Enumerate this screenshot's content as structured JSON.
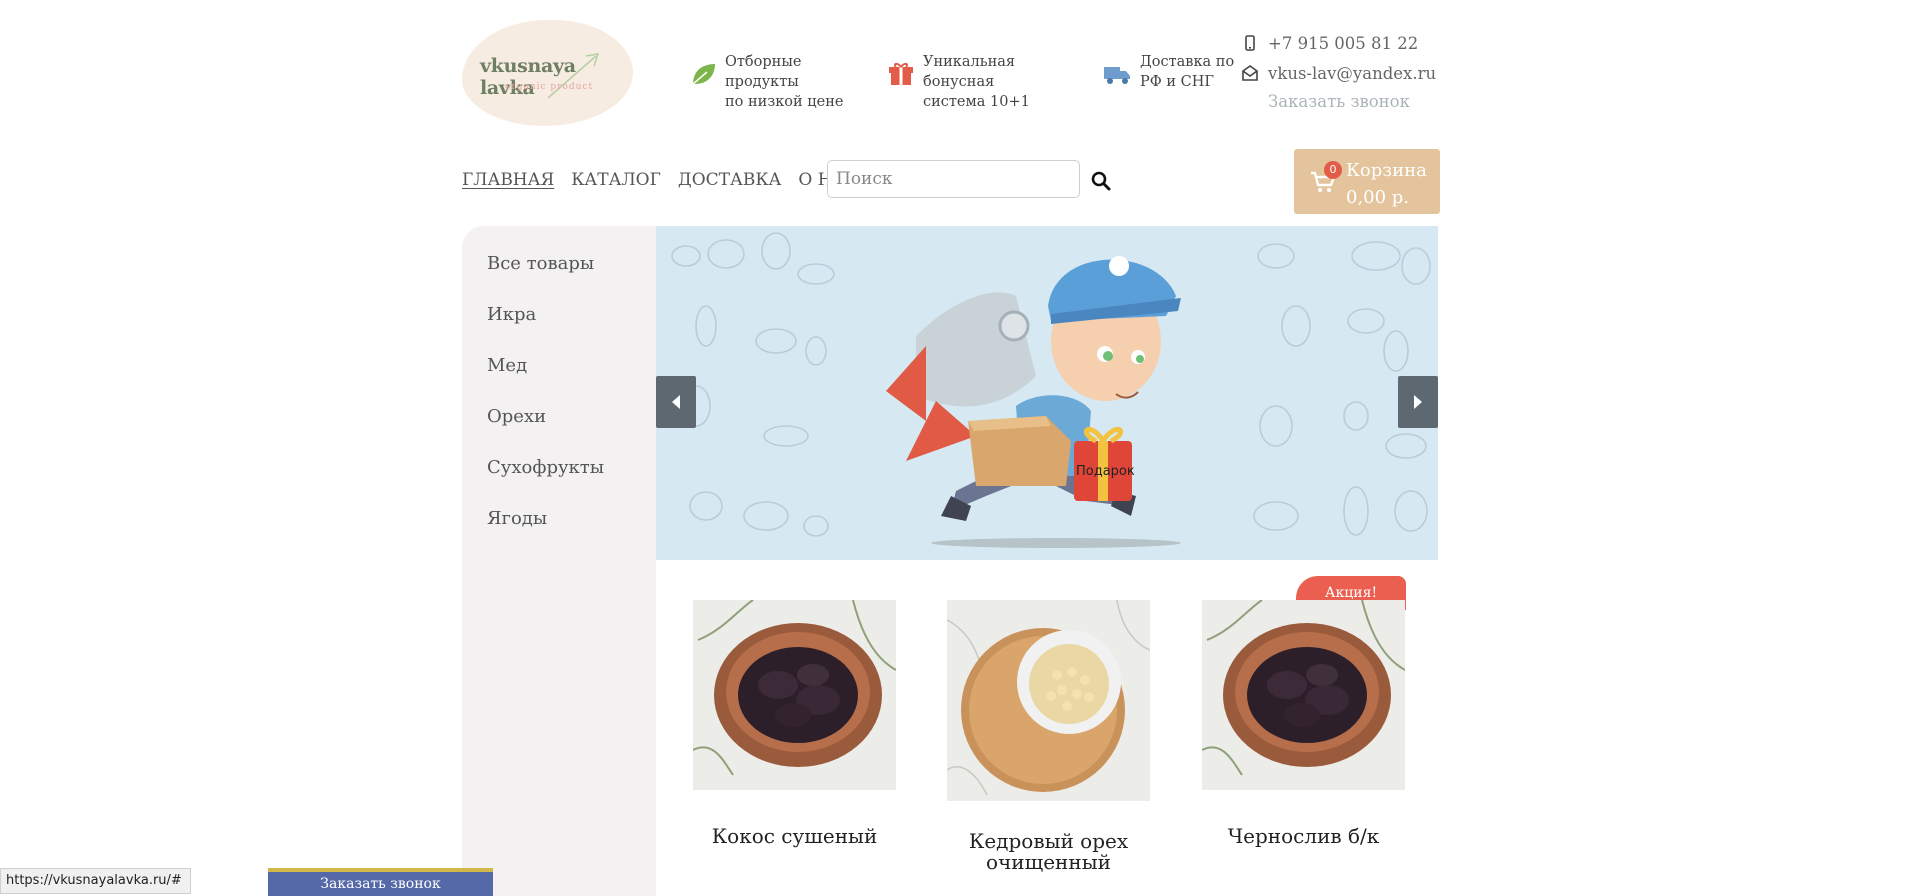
{
  "logo": {
    "title": "vkusnaya lavka",
    "subtitle": "organic product"
  },
  "features": [
    {
      "icon": "leaf-icon",
      "text1": "Отборные продукты",
      "text2": "по низкой цене"
    },
    {
      "icon": "gift-icon",
      "text1": "Уникальная бонусная",
      "text2": "система 10+1"
    },
    {
      "icon": "truck-icon",
      "text1": "Доставка по",
      "text2": "РФ и СНГ"
    }
  ],
  "contacts": {
    "phone": "+7 915 005 81 22",
    "email": "vkus-lav@yandex.ru",
    "callback": "Заказать звонок"
  },
  "nav": {
    "items": [
      "ГЛАВНАЯ",
      "КАТАЛОГ",
      "ДОСТАВКА",
      "О НАС"
    ],
    "active": "ГЛАВНАЯ"
  },
  "search": {
    "placeholder": "Поиск"
  },
  "cart": {
    "count": "0",
    "label": "Корзина",
    "total": "0,00 р."
  },
  "sidebar": {
    "items": [
      {
        "label": "Все товары"
      },
      {
        "label": "Икра"
      },
      {
        "label": "Мед"
      },
      {
        "label": "Орехи"
      },
      {
        "label": "Сухофрукты"
      },
      {
        "label": "Ягоды"
      }
    ]
  },
  "banner": {
    "gift_text": "Подарок"
  },
  "products": [
    {
      "name": "Кокос сушеный",
      "promo": ""
    },
    {
      "name": "Кедровый орех очищенный",
      "promo": ""
    },
    {
      "name": "Чернослив б/к",
      "promo": "Акция!"
    }
  ],
  "status_bar": {
    "url": "https://vkusnayalavka.ru/#"
  },
  "callback_bar": {
    "label": "Заказать звонок"
  },
  "colors": {
    "cart_bg": "#e3c49c",
    "badge": "#e25c49",
    "banner_bg": "#d6e9f3",
    "sidebar_bg": "#f3f1f1",
    "promo": "#ea5f50",
    "callback_bar": "#5568a8"
  }
}
